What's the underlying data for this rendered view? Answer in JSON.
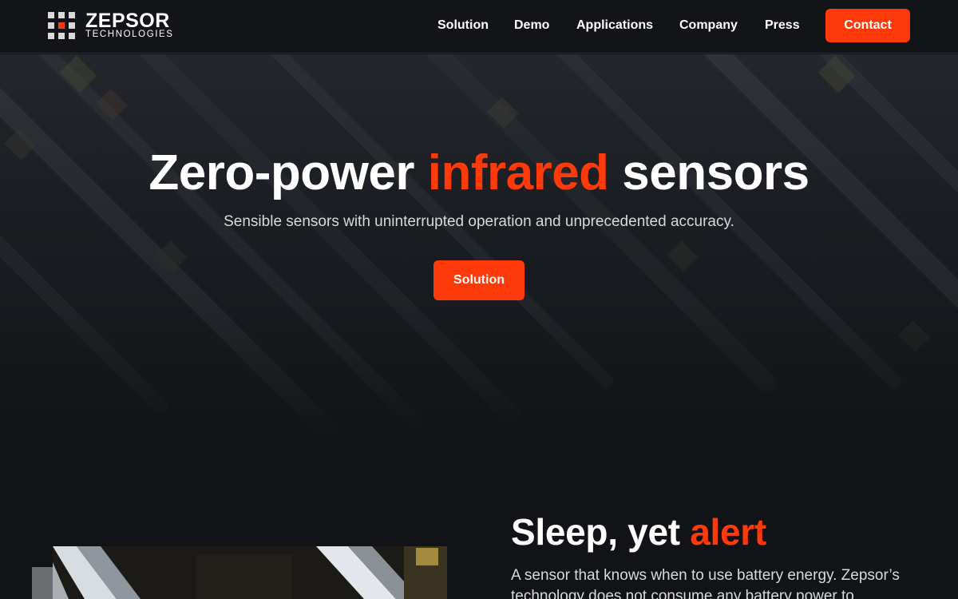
{
  "brand": {
    "name": "ZEPSOR",
    "subtitle": "TECHNOLOGIES",
    "accent_color": "#ff3a0a",
    "logo_icon": "grid-dots-icon"
  },
  "nav": {
    "items": [
      {
        "label": "Solution"
      },
      {
        "label": "Demo"
      },
      {
        "label": "Applications"
      },
      {
        "label": "Company"
      },
      {
        "label": "Press"
      }
    ],
    "contact_label": "Contact"
  },
  "hero": {
    "title_part1": "Zero-power ",
    "title_accent": "infrared",
    "title_part2": " sensors",
    "subtitle": "Sensible sensors with uninterrupted operation and unprecedented accuracy.",
    "button_label": "Solution"
  },
  "feature": {
    "title_part1": "Sleep, yet ",
    "title_accent": "alert",
    "body": "A sensor that knows when to use battery energy. Zepsor’s technology does not consume any battery power to"
  }
}
